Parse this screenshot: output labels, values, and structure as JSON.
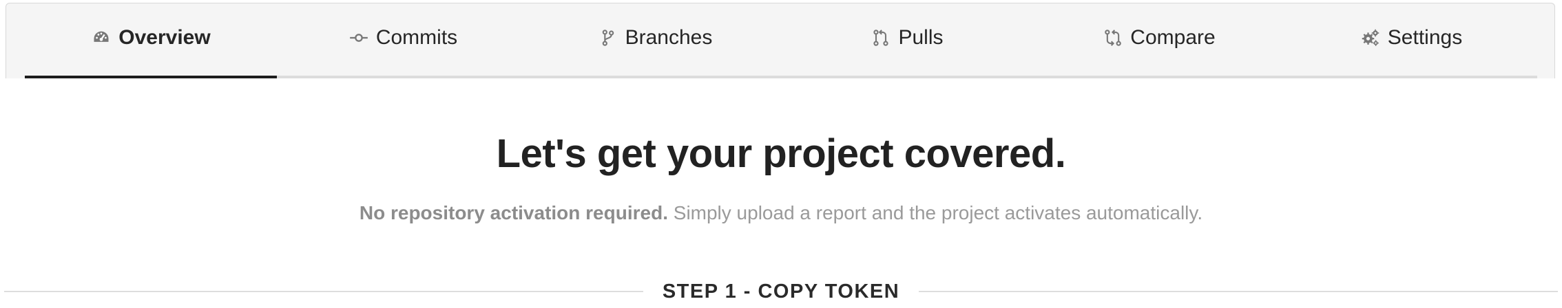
{
  "nav": {
    "tabs": [
      {
        "label": "Overview",
        "icon": "dashboard-icon",
        "active": true
      },
      {
        "label": "Commits",
        "icon": "commit-icon",
        "active": false
      },
      {
        "label": "Branches",
        "icon": "branch-icon",
        "active": false
      },
      {
        "label": "Pulls",
        "icon": "pull-request-icon",
        "active": false
      },
      {
        "label": "Compare",
        "icon": "compare-icon",
        "active": false
      },
      {
        "label": "Settings",
        "icon": "gears-icon",
        "active": false
      }
    ]
  },
  "main": {
    "headline": "Let's get your project covered.",
    "subline_strong": "No repository activation required.",
    "subline_rest": " Simply upload a report and the project activates automatically.",
    "step_label": "STEP 1 - COPY TOKEN"
  },
  "colors": {
    "text": "#222222",
    "muted": "#9a9a9a",
    "active_underline": "#1d1d1d",
    "divider": "#dddddd"
  }
}
